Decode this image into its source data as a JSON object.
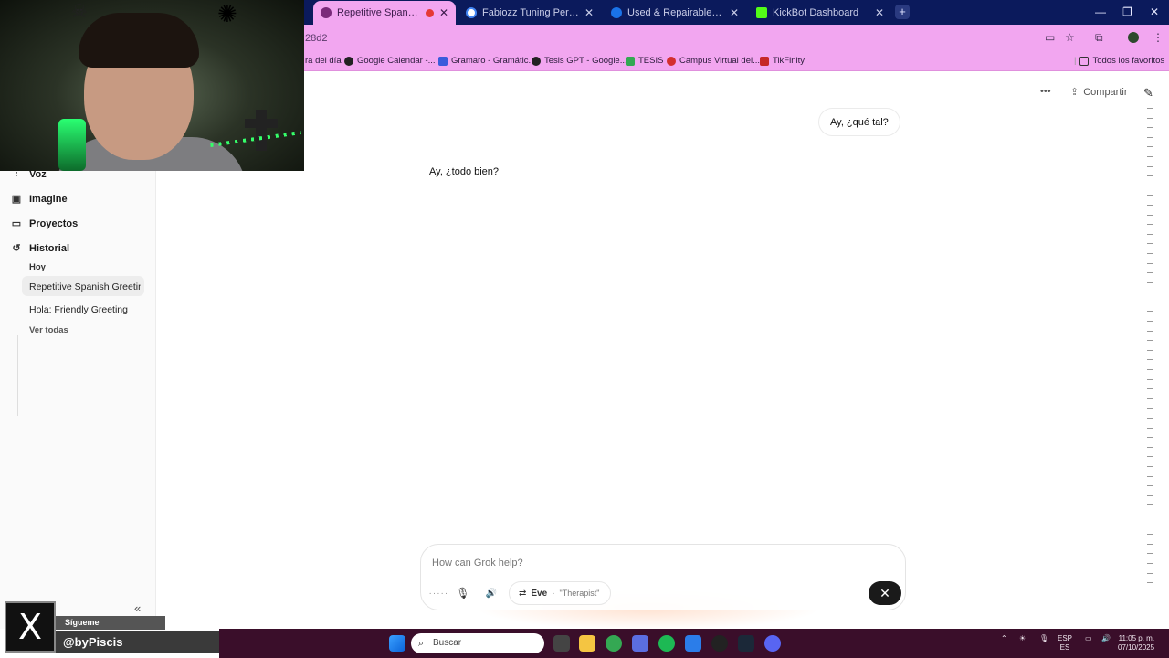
{
  "browser": {
    "tabs": [
      {
        "title": "Repetitive Spanish Greeting",
        "active": true,
        "favicon_color": "#7a2a7a"
      },
      {
        "title": "Fabiozz Tuning Performance - I",
        "active": false,
        "favicon_color": "#4285f4"
      },
      {
        "title": "Used & Repairable Salvage Veh",
        "active": false,
        "favicon_color": "#1a73e8"
      },
      {
        "title": "KickBot Dashboard",
        "active": false,
        "favicon_color": "#53fc18"
      }
    ],
    "url_fragment": "28d2",
    "bookmarks": [
      {
        "label": "ra del día"
      },
      {
        "label": "Google Calendar -..."
      },
      {
        "label": "Gramaro - Gramátic..."
      },
      {
        "label": "Tesis GPT - Google..."
      },
      {
        "label": "TESIS"
      },
      {
        "label": "Campus Virtual del..."
      },
      {
        "label": "TikFinity"
      }
    ],
    "all_bookmarks_label": "Todos los favoritos",
    "accent_color": "#f2a6f0"
  },
  "sidebar": {
    "items": [
      {
        "label": "Voz",
        "icon": "waveform-icon"
      },
      {
        "label": "Imagine",
        "icon": "image-icon"
      },
      {
        "label": "Proyectos",
        "icon": "folder-icon"
      },
      {
        "label": "Historial",
        "icon": "history-icon"
      }
    ],
    "history_group": "Hoy",
    "history": [
      {
        "label": "Repetitive Spanish Greetings",
        "active": true
      },
      {
        "label": "Hola: Friendly Greeting",
        "active": false
      }
    ],
    "see_all": "Ver todas"
  },
  "header": {
    "share_label": "Compartir"
  },
  "chat": {
    "user_message": "Ay, ¿qué tal?",
    "assistant_message": "Ay, ¿todo bien?"
  },
  "composer": {
    "placeholder": "How can Grok help?",
    "voice_name": "Eve",
    "voice_style": "\"Therapist\""
  },
  "overlay": {
    "follow_label": "Sígueme",
    "handle": "@byPiscis"
  },
  "taskbar": {
    "search_placeholder": "Buscar",
    "lang_top": "ESP",
    "lang_bottom": "ES",
    "time": "11:05 p. m.",
    "date": "07/10/2025"
  }
}
